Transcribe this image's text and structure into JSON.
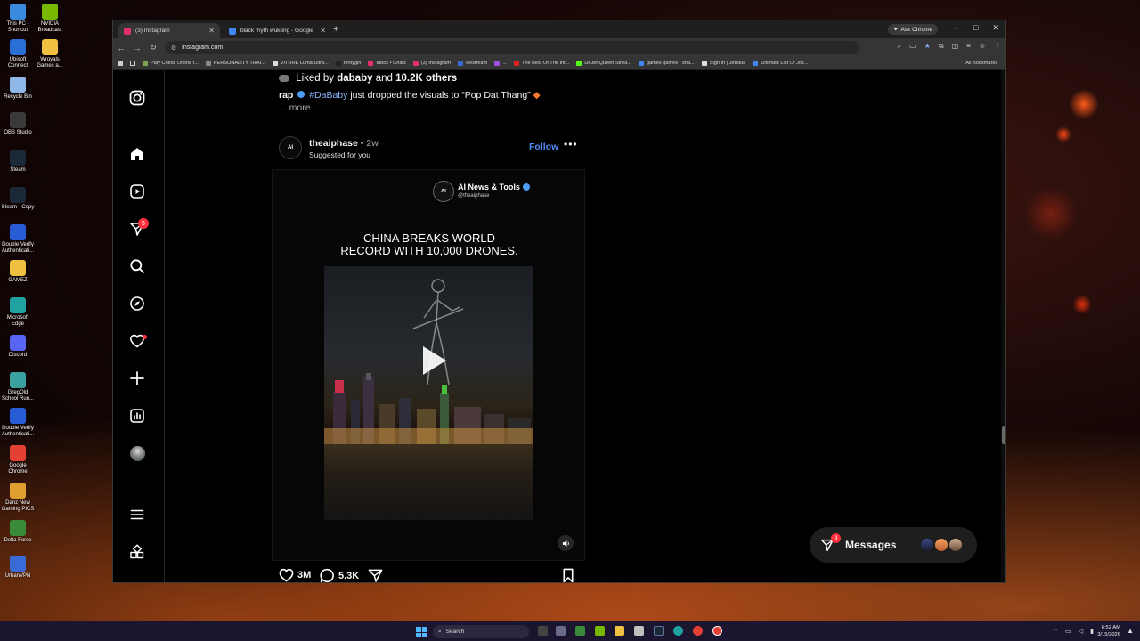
{
  "desktop": {
    "icons": [
      {
        "label": "This PC - Shortcut",
        "color": "#3a8be0"
      },
      {
        "label": "NVIDIA Broadcast",
        "color": "#76b900"
      },
      {
        "label": "Ubisoft Connect",
        "color": "#2a6fd6"
      },
      {
        "label": "Wroyals Games a...",
        "color": "#f0c040"
      },
      {
        "label": "Recycle Bin",
        "color": "#8fb8e8"
      },
      {
        "label": "OBS Studio",
        "color": "#3a3a3a"
      },
      {
        "label": "Steam",
        "color": "#1b2838"
      },
      {
        "label": "Steam - Copy",
        "color": "#1b2838"
      },
      {
        "label": "Double Verify Authenticati...",
        "color": "#2a5bd6"
      },
      {
        "label": "GAMEZ",
        "color": "#f0c040"
      },
      {
        "label": "Microsoft Edge",
        "color": "#1fa3a0"
      },
      {
        "label": "Discord",
        "color": "#5865f2"
      },
      {
        "label": "GregOld School Run...",
        "color": "#3aa0a0"
      },
      {
        "label": "Double Verify Authenticati...",
        "color": "#2a5bd6"
      },
      {
        "label": "Google Chrome",
        "color": "#e34133"
      },
      {
        "label": "Danz New Gaming PICS",
        "color": "#e0a030"
      },
      {
        "label": "Delta Force",
        "color": "#3a8a3a"
      },
      {
        "label": "UrbanVPN",
        "color": "#3a6ad6"
      }
    ]
  },
  "browser": {
    "tabs": [
      {
        "title": "(3) Instagram",
        "active": true,
        "icon_color": "#e1306c"
      },
      {
        "title": "black myth wukong - Google S",
        "active": false,
        "icon_color": "#4285f4"
      }
    ],
    "new_tab": "+",
    "ask_chrome": "Ask Chrome",
    "window_buttons": {
      "minimize": "–",
      "maximize": "□",
      "close": "✕"
    },
    "url": "instagram.com",
    "bookmarks": [
      {
        "label": "Play Chess Online f...",
        "color": "#7fa650"
      },
      {
        "label": "PERSONALITY TRAI...",
        "color": "#888888"
      },
      {
        "label": "VITURE Luma Ultra...",
        "color": "#dddddd"
      },
      {
        "label": "fentygirl",
        "color": "#222222"
      },
      {
        "label": "Inbox • Chats",
        "color": "#e1306c"
      },
      {
        "label": "(3) Instagram",
        "color": "#e1306c"
      },
      {
        "label": "Restream",
        "color": "#3a6ad6"
      },
      {
        "label": "...",
        "color": "#a050e0"
      },
      {
        "label": "The Best Of The Int...",
        "color": "#e02020"
      },
      {
        "label": "DeJenQueen Strea...",
        "color": "#53fc18"
      },
      {
        "label": "games games - sha...",
        "color": "#4285f4"
      },
      {
        "label": "Sign In | JetBlue",
        "color": "#dddddd"
      },
      {
        "label": "Ultimate List Of Jok...",
        "color": "#4285f4"
      }
    ],
    "all_bookmarks": "All Bookmarks"
  },
  "instagram": {
    "sidebar": [
      "instagram-logo-icon",
      "home-icon",
      "reels-icon",
      "messages-icon",
      "search-icon",
      "explore-icon",
      "notifications-icon",
      "create-icon",
      "dashboard-icon",
      "profile-avatar",
      "menu-icon",
      "apps-icon"
    ],
    "messages_badge": "5",
    "prev_post": {
      "liked_prefix": "Liked by",
      "liked_user": "dababy",
      "liked_and": "and",
      "liked_others": "10.2K others",
      "caption_user": "rap",
      "caption_tag": "#DaBaby",
      "caption_text": "just dropped the visuals to “Pop Dat Thang”",
      "more": "... more"
    },
    "post": {
      "username": "theaiphase",
      "time": "• 2w",
      "suggested": "Suggested for you",
      "follow": "Follow",
      "avatar_text": "AI",
      "media": {
        "brand_name": "AI News & Tools",
        "brand_handle": "@theaiphase",
        "headline_line1": "CHINA BREAKS WORLD",
        "headline_line2": "RECORD WITH 10,000 DRONES."
      },
      "likes": "3M",
      "comments": "5.3K"
    },
    "messages_bar": {
      "label": "Messages",
      "badge": "3"
    }
  },
  "taskbar": {
    "search": "Search",
    "time": "6:52 AM",
    "date": "3/15/2026"
  }
}
